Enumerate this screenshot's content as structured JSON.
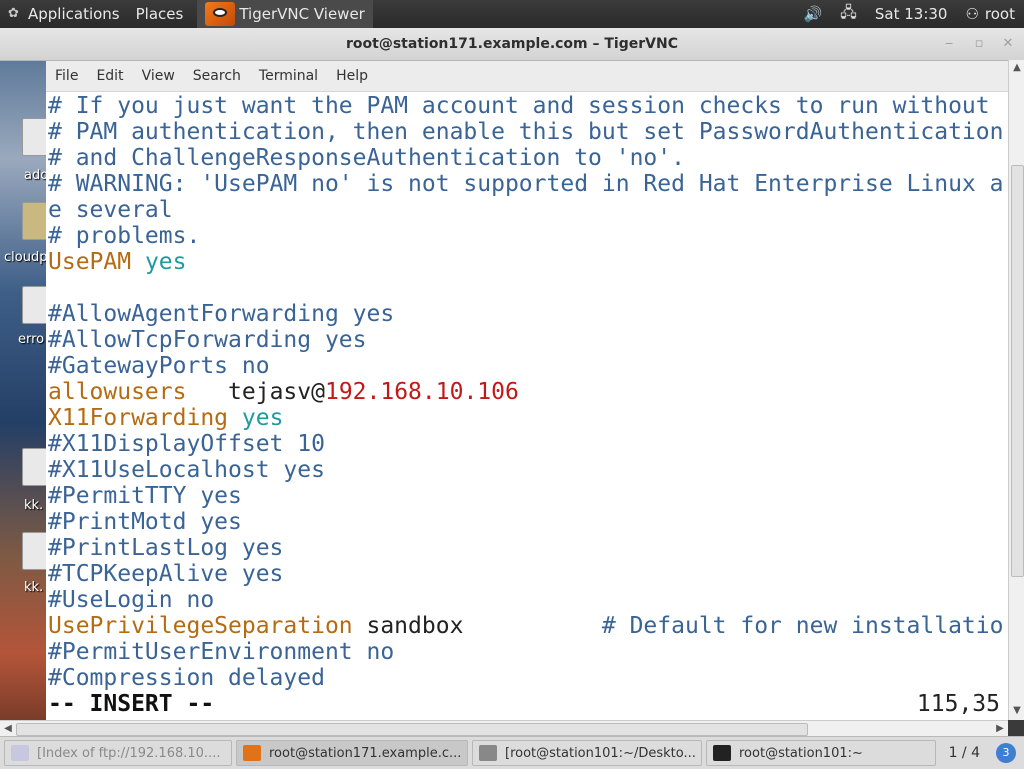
{
  "top_panel": {
    "applications": "Applications",
    "places": "Places",
    "active_app": "TigerVNC Viewer",
    "time": "Sat 13:30",
    "user": "root"
  },
  "window": {
    "title": "root@station171.example.com – TigerVNC"
  },
  "desktop": {
    "labels": [
      "ado",
      "cloudp",
      "erro",
      "kk.",
      "kk."
    ]
  },
  "menu": [
    "File",
    "Edit",
    "View",
    "Search",
    "Terminal",
    "Help"
  ],
  "editor": {
    "lines": [
      [
        {
          "t": "# If you just want the PAM account and session checks to run without",
          "c": "com"
        }
      ],
      [
        {
          "t": "# PAM authentication, then enable this but set PasswordAuthentication",
          "c": "com"
        }
      ],
      [
        {
          "t": "# and ChallengeResponseAuthentication to 'no'.",
          "c": "com"
        }
      ],
      [
        {
          "t": "# WARNING: 'UsePAM no' is not supported in Red Hat Enterprise Linux a",
          "c": "com"
        }
      ],
      [
        {
          "t": "e several",
          "c": "com"
        }
      ],
      [
        {
          "t": "# problems.",
          "c": "com"
        }
      ],
      [
        {
          "t": "UsePAM",
          "c": "key"
        },
        {
          "t": " ",
          "c": "txt"
        },
        {
          "t": "yes",
          "c": "val"
        }
      ],
      [
        {
          "t": "",
          "c": "txt"
        }
      ],
      [
        {
          "t": "#AllowAgentForwarding yes",
          "c": "com"
        }
      ],
      [
        {
          "t": "#AllowTcpForwarding yes",
          "c": "com"
        }
      ],
      [
        {
          "t": "#GatewayPorts no",
          "c": "com"
        }
      ],
      [
        {
          "t": "allowusers",
          "c": "key"
        },
        {
          "t": "   tejasv@",
          "c": "txt"
        },
        {
          "t": "192.168.10.106",
          "c": "ip"
        }
      ],
      [
        {
          "t": "X11Forwarding",
          "c": "key"
        },
        {
          "t": " ",
          "c": "txt"
        },
        {
          "t": "yes",
          "c": "val"
        }
      ],
      [
        {
          "t": "#X11DisplayOffset 10",
          "c": "com"
        }
      ],
      [
        {
          "t": "#X11UseLocalhost yes",
          "c": "com"
        }
      ],
      [
        {
          "t": "#PermitTTY yes",
          "c": "com"
        }
      ],
      [
        {
          "t": "#PrintMotd yes",
          "c": "com"
        }
      ],
      [
        {
          "t": "#PrintLastLog yes",
          "c": "com"
        }
      ],
      [
        {
          "t": "#TCPKeepAlive yes",
          "c": "com"
        }
      ],
      [
        {
          "t": "#UseLogin no",
          "c": "com"
        }
      ],
      [
        {
          "t": "UsePrivilegeSeparation",
          "c": "key"
        },
        {
          "t": " sandbox          ",
          "c": "txt"
        },
        {
          "t": "# Default for new installatio",
          "c": "com"
        }
      ],
      [
        {
          "t": "#PermitUserEnvironment no",
          "c": "com"
        }
      ],
      [
        {
          "t": "#Compression delayed",
          "c": "com"
        }
      ]
    ],
    "mode": "-- INSERT --",
    "cursor_position": "115,35"
  },
  "taskbar": {
    "tasks": [
      {
        "label": "[Index of ftp://192.168.10....",
        "state": "dim"
      },
      {
        "label": "root@station171.example.c...",
        "state": "active"
      },
      {
        "label": "[root@station101:~/Deskto...",
        "state": "normal"
      },
      {
        "label": "root@station101:~",
        "state": "normal"
      }
    ],
    "workspace": "1 / 4",
    "badge": "3"
  },
  "colors": {
    "comment": "#3a6496",
    "keyword": "#b56b12",
    "value": "#1f9aa0",
    "ip": "#c41818"
  }
}
